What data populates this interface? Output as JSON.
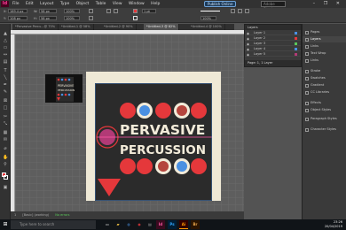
{
  "menubar": {
    "logo": "Id",
    "menus": [
      "File",
      "Edit",
      "Layout",
      "Type",
      "Object",
      "Table",
      "View",
      "Window",
      "Help"
    ],
    "publish_label": "Publish Online",
    "search_placeholder": "Adobe Stock",
    "window_controls": "– ❐ ✕"
  },
  "controlbar": {
    "x_label": "X:",
    "x_value": "169.4 px",
    "y_label": "Y:",
    "y_value": "108 px",
    "w_label": "W:",
    "w_value": "58 px",
    "h_label": "H:",
    "h_value": "58 px",
    "zoom": "100%",
    "stroke_weight": "1 pt",
    "opacity": "100%"
  },
  "tabs": [
    {
      "label": "*Pervasive Percu...@ 75%",
      "active": false
    },
    {
      "label": "*Untitled-1 @ 58%",
      "active": false
    },
    {
      "label": "*Untitled-2 @ 90%",
      "active": false
    },
    {
      "label": "*Untitled-3 @ 82%",
      "active": true
    },
    {
      "label": "*Untitled-4 @ 100%",
      "active": false
    }
  ],
  "artwork": {
    "line1": "PERVASIVE",
    "line2": "PERCUSSION",
    "colors": {
      "red": "#e5383b",
      "blue": "#4a90e2",
      "cream": "#f2ebd9",
      "dark": "#2b2b2b",
      "magenta": "#b23a76",
      "pink_guide": "#ff5aa8"
    }
  },
  "statusbar": {
    "page": "1",
    "mode": "[Basic] (working)",
    "status": "No errors"
  },
  "layers_panel": {
    "title": "Layers",
    "rows": [
      "Layer 1",
      "Layer 2",
      "Layer 3",
      "Layer 4",
      "Layer 5"
    ],
    "footer": "Page: 1, 1 Layer"
  },
  "side_panels": [
    {
      "label": "Pages",
      "icon": "pages-icon",
      "active": false
    },
    {
      "label": "Layers",
      "icon": "layers-icon",
      "active": true
    },
    {
      "label": "Links",
      "icon": "links-icon",
      "active": false
    },
    {
      "label": "Text Wrap",
      "icon": "text-wrap-icon",
      "active": false
    },
    {
      "label": "Links",
      "icon": "chain-icon",
      "active": false
    },
    {
      "label": "Stroke",
      "icon": "stroke-icon",
      "active": false
    },
    {
      "label": "Swatches",
      "icon": "swatches-icon",
      "active": false
    },
    {
      "label": "Gradient",
      "icon": "gradient-icon",
      "active": false
    },
    {
      "label": "CC Libraries",
      "icon": "cc-libraries-icon",
      "active": false
    },
    {
      "label": "Effects",
      "icon": "effects-icon",
      "active": false
    },
    {
      "label": "Object Styles",
      "icon": "object-styles-icon",
      "active": false
    },
    {
      "label": "Paragraph Styles",
      "icon": "paragraph-styles-icon",
      "active": false
    },
    {
      "label": "Character Styles",
      "icon": "character-styles-icon",
      "active": false
    }
  ],
  "taskbar": {
    "search_placeholder": "Type here to search",
    "apps": [
      "Id",
      "Ps",
      "Ai",
      "Br"
    ],
    "time": "23:26",
    "date": "20/04/2019"
  }
}
